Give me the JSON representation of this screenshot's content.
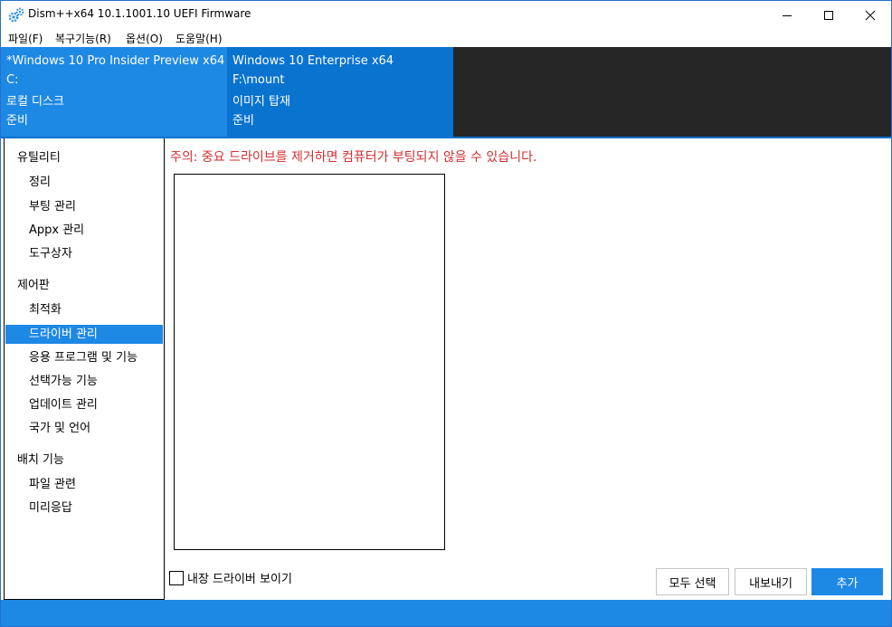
{
  "window": {
    "title": "Dism++x64 10.1.1001.10 UEFI Firmware",
    "app_icon": "gears-icon",
    "controls": [
      "minimize-icon",
      "maximize-icon",
      "close-icon"
    ]
  },
  "menu": [
    "파일(F)",
    "복구기능(R)",
    "옵션(O)",
    "도움말(H)"
  ],
  "sessions": [
    {
      "name": "*Windows 10 Pro Insider Preview x64",
      "path": "C:",
      "type": "로컬 디스크",
      "status": "준비",
      "selected": true
    },
    {
      "name": "Windows 10 Enterprise x64",
      "path": "F:\\mount",
      "type": "이미지 탑재",
      "status": "준비",
      "selected": false
    }
  ],
  "sidebar": {
    "groups": [
      {
        "label": "유틸리티",
        "items": [
          "정리",
          "부팅 관리",
          "Appx 관리",
          "도구상자"
        ]
      },
      {
        "label": "제어판",
        "items": [
          "최적화",
          "드라이버 관리",
          "응용 프로그램 및 기능",
          "선택가능 기능",
          "업데이트 관리",
          "국가 및 언어"
        ]
      },
      {
        "label": "배치 기능",
        "items": [
          "파일 관련",
          "미리응답"
        ]
      }
    ],
    "selected_item": "드라이버 관리"
  },
  "main": {
    "warning": "주의: 중요 드라이브를 제거하면 컴퓨터가 부팅되지 않을 수 있습니다.",
    "show_builtin_label": "내장 드라이버 보이기",
    "show_builtin_checked": false,
    "buttons": {
      "select_all": "모두 선택",
      "export": "내보내기",
      "add": "추가"
    }
  },
  "colors": {
    "accent": "#1e88e5",
    "accent_dark": "#0a73d0",
    "warning": "#d32f2f",
    "session_bg": "#262626"
  }
}
